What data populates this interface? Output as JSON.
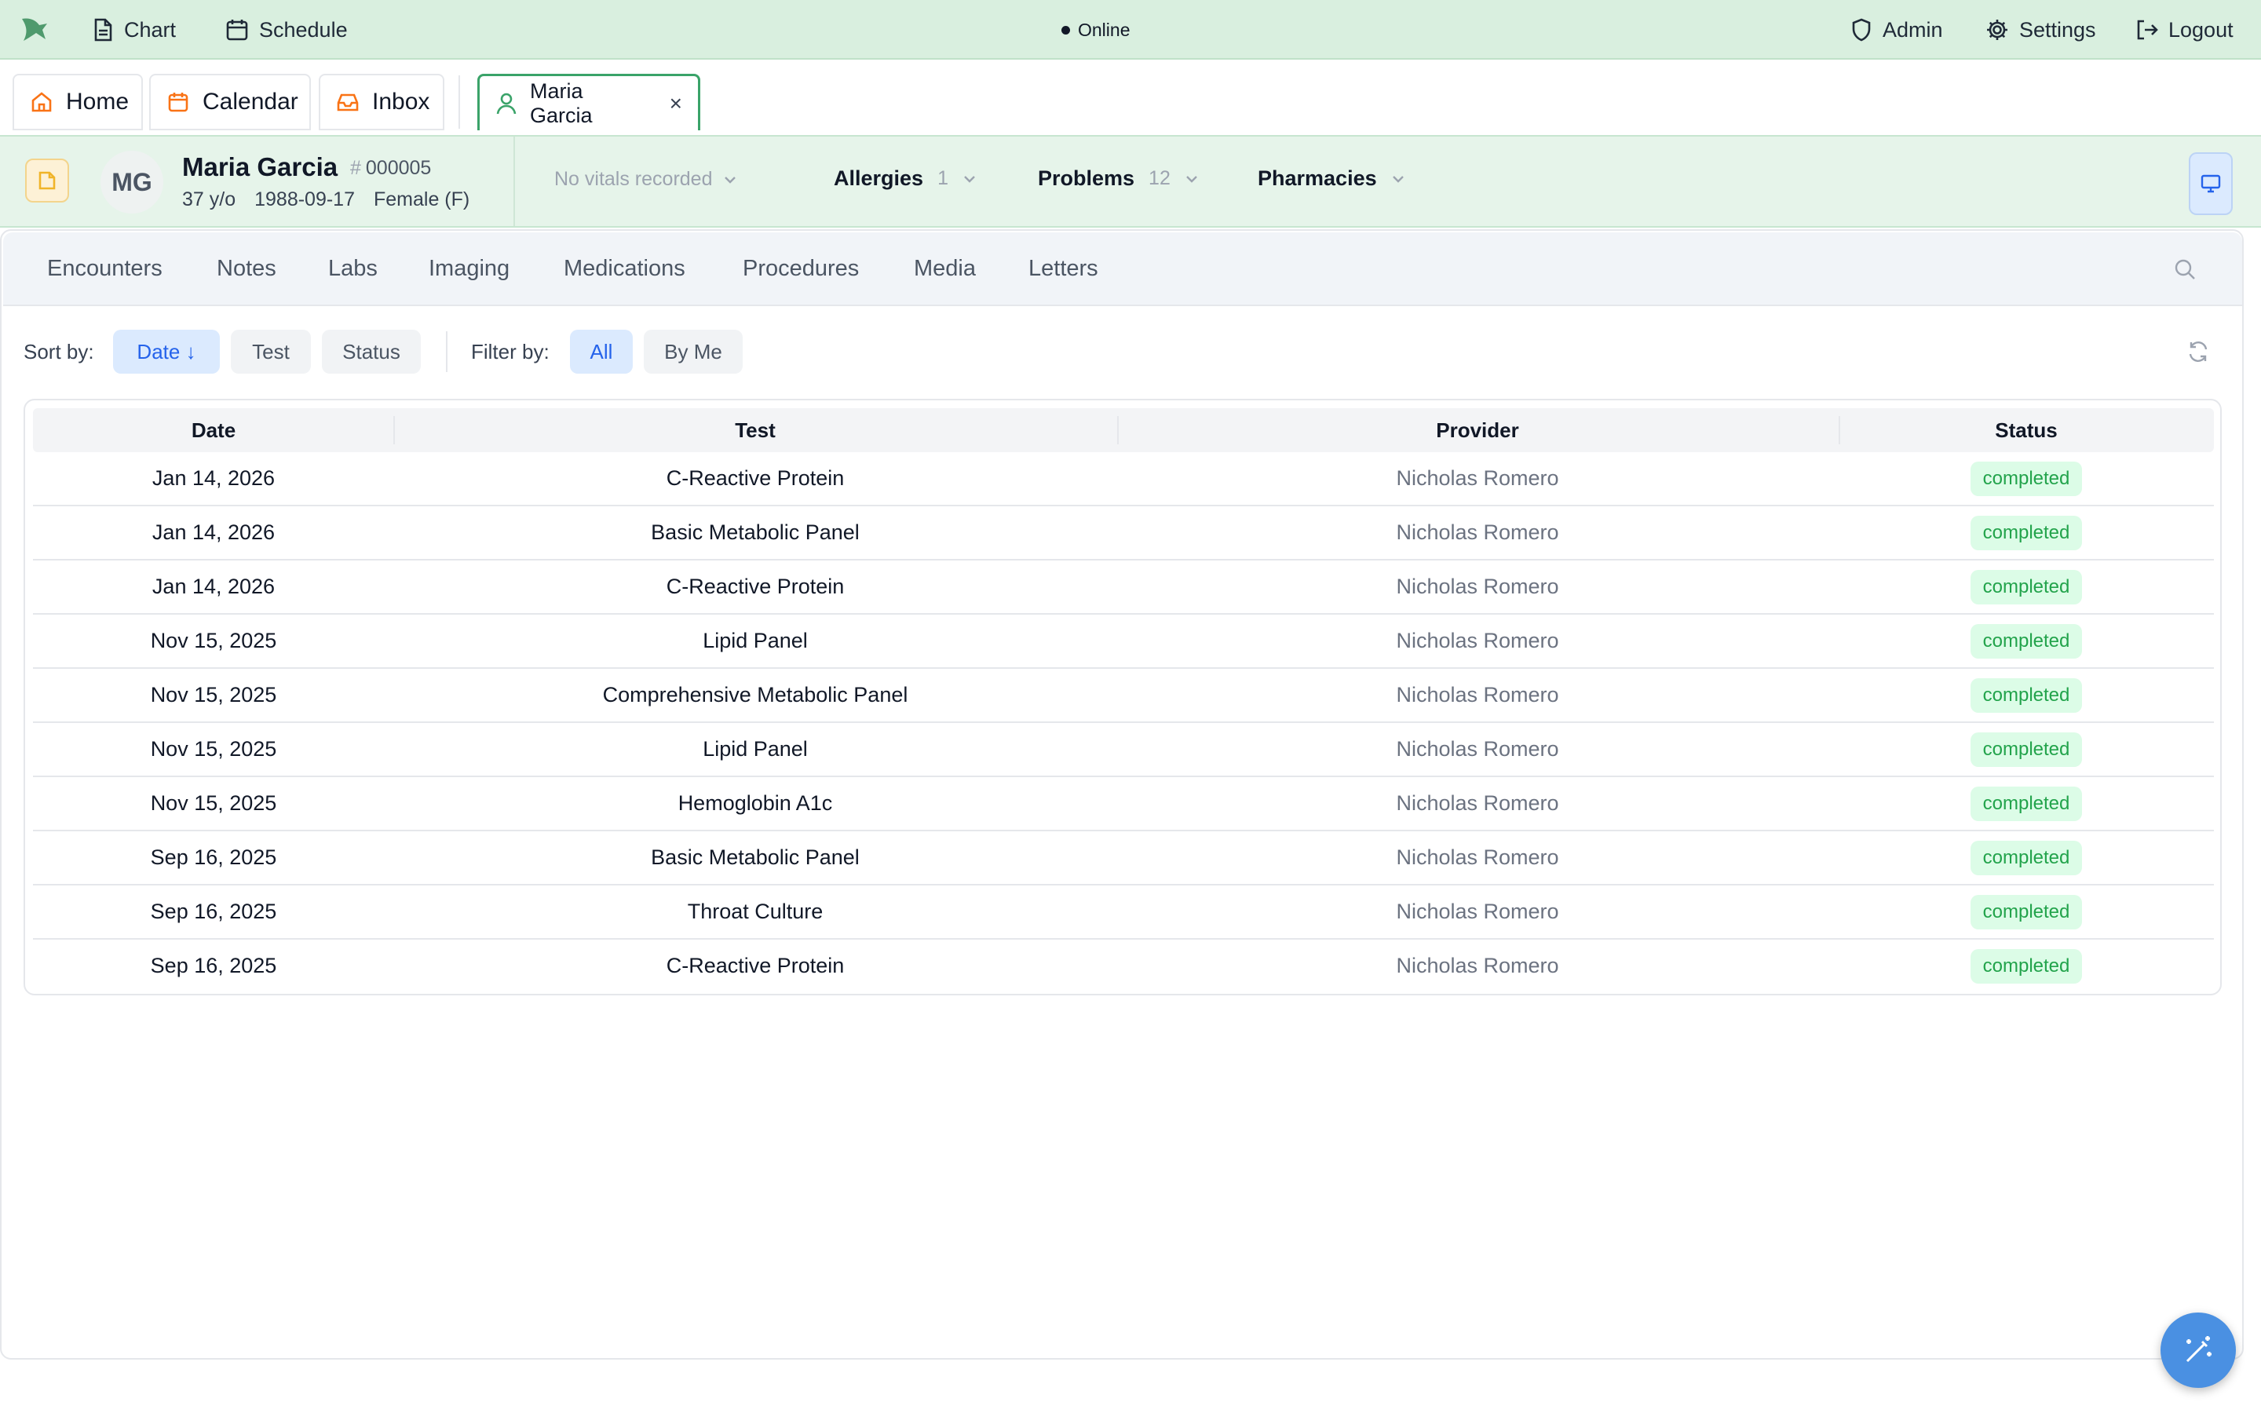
{
  "topbar": {
    "chart_label": "Chart",
    "schedule_label": "Schedule",
    "status_label": "Online",
    "admin_label": "Admin",
    "settings_label": "Settings",
    "logout_label": "Logout"
  },
  "tabs": {
    "home": "Home",
    "calendar": "Calendar",
    "inbox": "Inbox",
    "patient": "Maria Garcia",
    "close": "×"
  },
  "patient": {
    "initials": "MG",
    "name": "Maria Garcia",
    "hash": "#",
    "id": "000005",
    "age": "37 y/o",
    "dob": "1988-09-17",
    "sex": "Female (F)",
    "vitals": "No vitals recorded",
    "allergies_label": "Allergies",
    "allergies_count": "1",
    "problems_label": "Problems",
    "problems_count": "12",
    "pharmacies_label": "Pharmacies"
  },
  "subnav": [
    "Encounters",
    "Notes",
    "Labs",
    "Imaging",
    "Medications",
    "Procedures",
    "Media",
    "Letters"
  ],
  "toolbar": {
    "sort_label": "Sort by:",
    "sort_date": "Date ↓",
    "sort_test": "Test",
    "sort_status": "Status",
    "filter_label": "Filter by:",
    "filter_all": "All",
    "filter_me": "By Me"
  },
  "table": {
    "headers": [
      "Date",
      "Test",
      "Provider",
      "Status"
    ],
    "rows": [
      {
        "date": "Jan 14, 2026",
        "test": "C-Reactive Protein",
        "provider": "Nicholas Romero",
        "status": "completed"
      },
      {
        "date": "Jan 14, 2026",
        "test": "Basic Metabolic Panel",
        "provider": "Nicholas Romero",
        "status": "completed"
      },
      {
        "date": "Jan 14, 2026",
        "test": "C-Reactive Protein",
        "provider": "Nicholas Romero",
        "status": "completed"
      },
      {
        "date": "Nov 15, 2025",
        "test": "Lipid Panel",
        "provider": "Nicholas Romero",
        "status": "completed"
      },
      {
        "date": "Nov 15, 2025",
        "test": "Comprehensive Metabolic Panel",
        "provider": "Nicholas Romero",
        "status": "completed"
      },
      {
        "date": "Nov 15, 2025",
        "test": "Lipid Panel",
        "provider": "Nicholas Romero",
        "status": "completed"
      },
      {
        "date": "Nov 15, 2025",
        "test": "Hemoglobin A1c",
        "provider": "Nicholas Romero",
        "status": "completed"
      },
      {
        "date": "Sep 16, 2025",
        "test": "Basic Metabolic Panel",
        "provider": "Nicholas Romero",
        "status": "completed"
      },
      {
        "date": "Sep 16, 2025",
        "test": "Throat Culture",
        "provider": "Nicholas Romero",
        "status": "completed"
      },
      {
        "date": "Sep 16, 2025",
        "test": "C-Reactive Protein",
        "provider": "Nicholas Romero",
        "status": "completed"
      }
    ]
  },
  "colors": {
    "topbar_bg": "#d9efdf",
    "active_tab_border": "#3aa369",
    "banner_bg": "#e6f4ea",
    "accent_blue": "#2563eb",
    "status_green": "#22a34b",
    "fab_blue": "#4a90e2"
  },
  "icons": {
    "logo": "app-logo",
    "chart": "document-icon",
    "schedule": "calendar-icon",
    "admin": "shield-icon",
    "settings": "gear-icon",
    "logout": "logout-icon",
    "home": "home-icon",
    "inbox": "inbox-icon",
    "patient": "user-icon",
    "search": "search-icon",
    "refresh": "refresh-icon",
    "fab": "magic-wand-icon"
  }
}
